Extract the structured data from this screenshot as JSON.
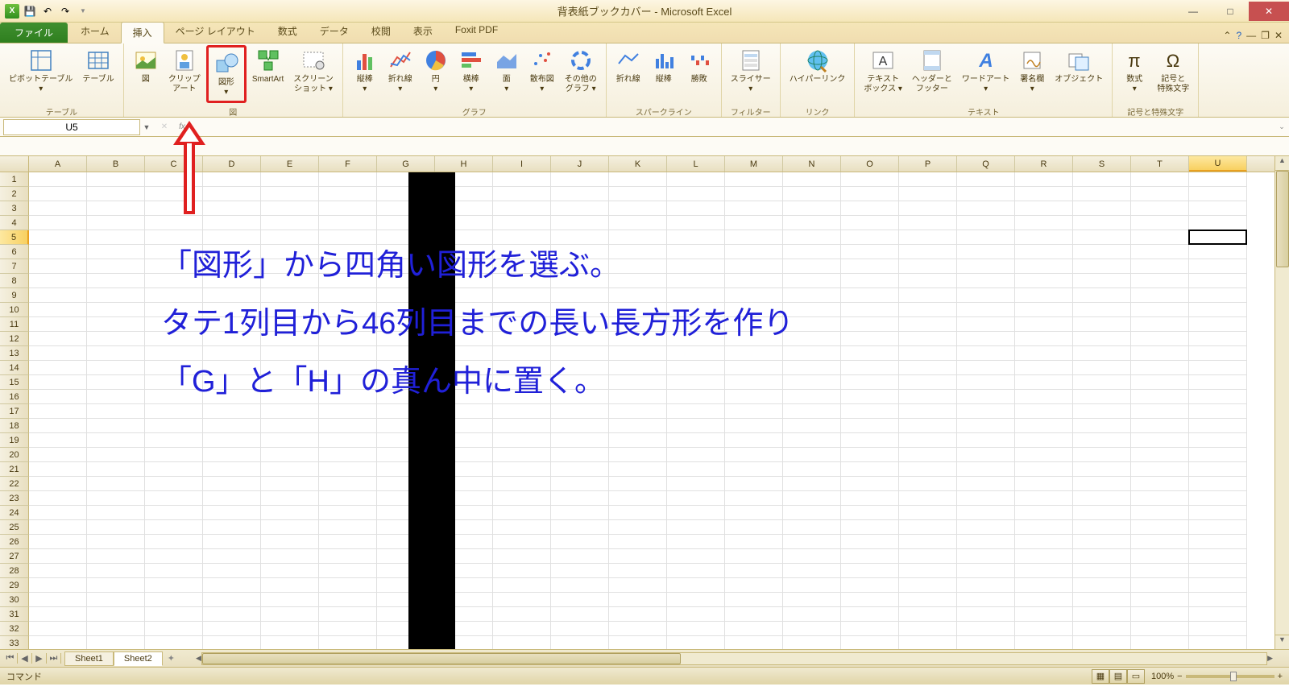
{
  "title": "背表紙ブックカバー - Microsoft Excel",
  "qat": {
    "save": "save",
    "undo": "undo",
    "redo": "redo"
  },
  "tabs": {
    "file": "ファイル",
    "items": [
      "ホーム",
      "挿入",
      "ページ レイアウト",
      "数式",
      "データ",
      "校閲",
      "表示",
      "Foxit PDF"
    ],
    "active_index": 1
  },
  "ribbon_groups": [
    {
      "label": "テーブル",
      "items": [
        {
          "name": "pivot-table",
          "label": "ピボットテーブル\n▾"
        },
        {
          "name": "table",
          "label": "テーブル"
        }
      ]
    },
    {
      "label": "図",
      "items": [
        {
          "name": "picture",
          "label": "図"
        },
        {
          "name": "clipart",
          "label": "クリップ\nアート"
        },
        {
          "name": "shapes",
          "label": "図形\n▾",
          "highlight": true
        },
        {
          "name": "smartart",
          "label": "SmartArt"
        },
        {
          "name": "screenshot",
          "label": "スクリーン\nショット ▾"
        }
      ]
    },
    {
      "label": "グラフ",
      "items": [
        {
          "name": "column-chart",
          "label": "縦棒\n▾"
        },
        {
          "name": "line-chart",
          "label": "折れ線\n▾"
        },
        {
          "name": "pie-chart",
          "label": "円\n▾"
        },
        {
          "name": "bar-chart",
          "label": "横棒\n▾"
        },
        {
          "name": "area-chart",
          "label": "面\n▾"
        },
        {
          "name": "scatter-chart",
          "label": "散布図\n▾"
        },
        {
          "name": "other-chart",
          "label": "その他の\nグラフ ▾"
        }
      ]
    },
    {
      "label": "スパークライン",
      "items": [
        {
          "name": "sparkline-line",
          "label": "折れ線"
        },
        {
          "name": "sparkline-column",
          "label": "縦棒"
        },
        {
          "name": "sparkline-winloss",
          "label": "勝敗"
        }
      ]
    },
    {
      "label": "フィルター",
      "items": [
        {
          "name": "slicer",
          "label": "スライサー\n▾"
        }
      ]
    },
    {
      "label": "リンク",
      "items": [
        {
          "name": "hyperlink",
          "label": "ハイパーリンク"
        }
      ]
    },
    {
      "label": "テキスト",
      "items": [
        {
          "name": "textbox",
          "label": "テキスト\nボックス ▾"
        },
        {
          "name": "header-footer",
          "label": "ヘッダーと\nフッター"
        },
        {
          "name": "wordart",
          "label": "ワードアート\n▾"
        },
        {
          "name": "signature",
          "label": "署名欄\n▾"
        },
        {
          "name": "object",
          "label": "オブジェクト"
        }
      ]
    },
    {
      "label": "記号と特殊文字",
      "items": [
        {
          "name": "equation",
          "label": "数式\n▾"
        },
        {
          "name": "symbol",
          "label": "記号と\n特殊文字"
        }
      ]
    }
  ],
  "name_box": "U5",
  "columns": [
    "A",
    "B",
    "C",
    "D",
    "E",
    "F",
    "G",
    "H",
    "I",
    "J",
    "K",
    "L",
    "M",
    "N",
    "O",
    "P",
    "Q",
    "R",
    "S",
    "T",
    "U"
  ],
  "selected_col": "U",
  "row_count": 33,
  "selected_row": 5,
  "annotation_lines": [
    "「図形」から四角い図形を選ぶ。",
    "タテ1列目から46列目までの長い長方形を作り",
    "「G」と「H」の真ん中に置く。"
  ],
  "sheets": {
    "items": [
      "Sheet1",
      "Sheet2"
    ],
    "active_index": 1
  },
  "status": {
    "left": "コマンド",
    "zoom": "100%"
  }
}
